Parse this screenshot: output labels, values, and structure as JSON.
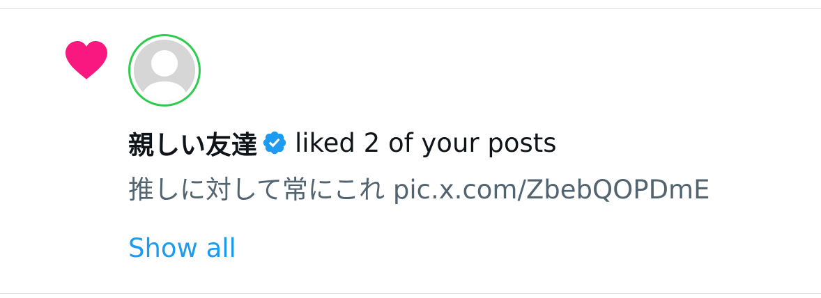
{
  "notification": {
    "type_icon": "heart-icon",
    "type_icon_color": "#f91880",
    "avatar_ring_color": "#2ecc4e",
    "avatar_placeholder_color": "#d6d6d6",
    "user_display_name": "親しい友達",
    "verified_icon": "verified-badge-icon",
    "verified_color": "#1d9bf0",
    "action_text": "liked 2 of your posts",
    "post_preview": "推しに対して常にこれ pic.x.com/ZbebQOPDmE",
    "show_all_label": "Show all",
    "link_color": "#1d9bf0"
  }
}
